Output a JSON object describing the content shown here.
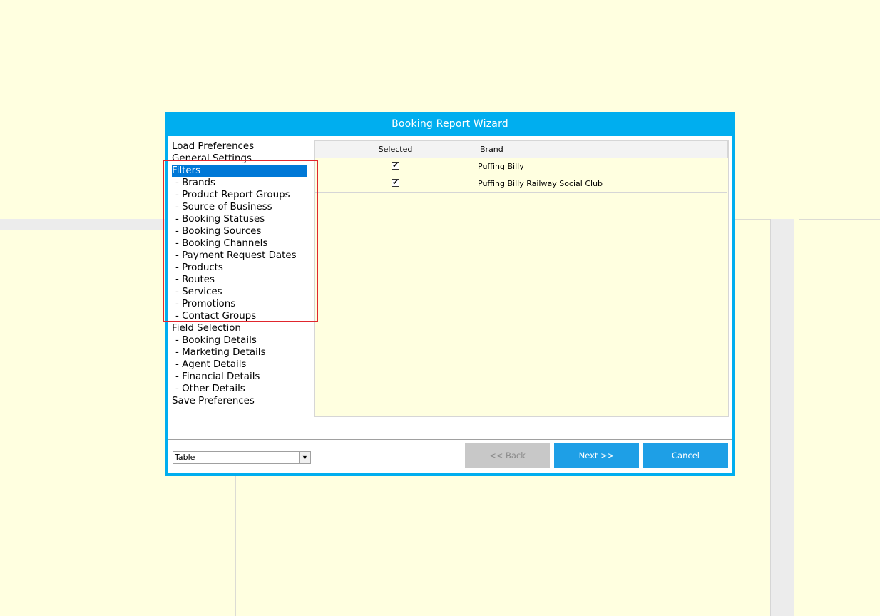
{
  "dialog": {
    "title": "Booking Report Wizard"
  },
  "nav": {
    "items": [
      {
        "label": "Load Preferences",
        "sub": false,
        "selected": false
      },
      {
        "label": "General Settings",
        "sub": false,
        "selected": false
      },
      {
        "label": "Filters",
        "sub": false,
        "selected": true
      },
      {
        "label": "- Brands",
        "sub": true,
        "selected": false
      },
      {
        "label": "- Product Report Groups",
        "sub": true,
        "selected": false
      },
      {
        "label": "- Source of Business",
        "sub": true,
        "selected": false
      },
      {
        "label": "- Booking Statuses",
        "sub": true,
        "selected": false
      },
      {
        "label": "- Booking Sources",
        "sub": true,
        "selected": false
      },
      {
        "label": "- Booking Channels",
        "sub": true,
        "selected": false
      },
      {
        "label": "- Payment Request Dates",
        "sub": true,
        "selected": false
      },
      {
        "label": "- Products",
        "sub": true,
        "selected": false
      },
      {
        "label": "- Routes",
        "sub": true,
        "selected": false
      },
      {
        "label": "- Services",
        "sub": true,
        "selected": false
      },
      {
        "label": "- Promotions",
        "sub": true,
        "selected": false
      },
      {
        "label": "- Contact Groups",
        "sub": true,
        "selected": false
      },
      {
        "label": "Field Selection",
        "sub": false,
        "selected": false
      },
      {
        "label": "- Booking Details",
        "sub": true,
        "selected": false
      },
      {
        "label": "- Marketing Details",
        "sub": true,
        "selected": false
      },
      {
        "label": "- Agent Details",
        "sub": true,
        "selected": false
      },
      {
        "label": "- Financial Details",
        "sub": true,
        "selected": false
      },
      {
        "label": "- Other Details",
        "sub": true,
        "selected": false
      },
      {
        "label": "Save Preferences",
        "sub": false,
        "selected": false
      }
    ]
  },
  "grid": {
    "columns": {
      "selected": "Selected",
      "brand": "Brand"
    },
    "rows": [
      {
        "selected": true,
        "brand": "Puffing Billy"
      },
      {
        "selected": true,
        "brand": "Puffing Billy Railway Social Club"
      }
    ]
  },
  "footer": {
    "view_value": "Table",
    "back_label": "<< Back",
    "next_label": "Next >>",
    "cancel_label": "Cancel"
  },
  "colors": {
    "dialog_accent": "#00aeef",
    "selection": "#0078d7",
    "button": "#1e9fe6",
    "highlight_box": "#e0262d",
    "background": "#ffffe0"
  },
  "icons": {
    "check": "checkmark-icon",
    "dropdown": "chevron-down-icon"
  }
}
